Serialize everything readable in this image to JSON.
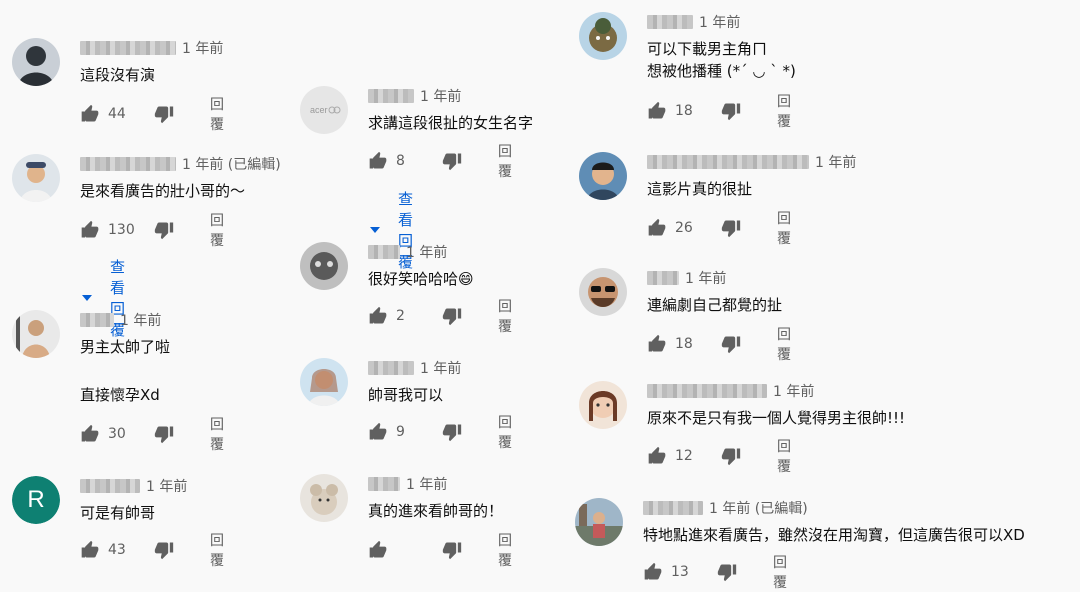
{
  "colors": {
    "link": "#065fd4",
    "meta": "#606060",
    "icon": "#606060",
    "letter_avatar_bg": "#0e8072"
  },
  "labels": {
    "reply": "回覆",
    "view_replies": "查看回覆"
  },
  "comments": [
    {
      "time": "1 年前",
      "lines": [
        "這段沒有演"
      ],
      "likes": "44"
    },
    {
      "time": "1 年前 (已編輯)",
      "lines": [
        "是來看廣告的壯小哥的～"
      ],
      "likes": "130"
    },
    {
      "time": "1 年前",
      "lines": [
        "男主太帥了啦",
        "",
        "直接懷孕Xd"
      ],
      "likes": "30"
    },
    {
      "time": "1 年前",
      "letter": "R",
      "lines": [
        "可是有帥哥"
      ],
      "likes": "43"
    },
    {
      "time": "1 年前",
      "lines": [
        "求講這段很扯的女生名字"
      ],
      "likes": "8"
    },
    {
      "time": "1 年前",
      "lines": [
        "很好笑哈哈哈😄"
      ],
      "likes": "2"
    },
    {
      "time": "1 年前",
      "lines": [
        "帥哥我可以"
      ],
      "likes": "9"
    },
    {
      "time": "1 年前",
      "lines": [
        "真的進來看帥哥的！"
      ],
      "likes": ""
    },
    {
      "time": "1 年前",
      "lines": [
        "可以下載男主角ㄇ",
        "想被他播種 (*´ ◡ ` *)"
      ],
      "likes": "18"
    },
    {
      "time": "1 年前",
      "lines": [
        "這影片真的很扯"
      ],
      "likes": "26"
    },
    {
      "time": "1 年前",
      "lines": [
        "連編劇自己都覺的扯"
      ],
      "likes": "18"
    },
    {
      "time": "1 年前",
      "lines": [
        "原來不是只有我一個人覺得男主很帥!!!"
      ],
      "likes": "12"
    },
    {
      "time": "1 年前 (已編輯)",
      "lines": [
        "特地點進來看廣告，雖然沒在用淘寶，但這廣告很可以XD"
      ],
      "likes": "13"
    }
  ]
}
